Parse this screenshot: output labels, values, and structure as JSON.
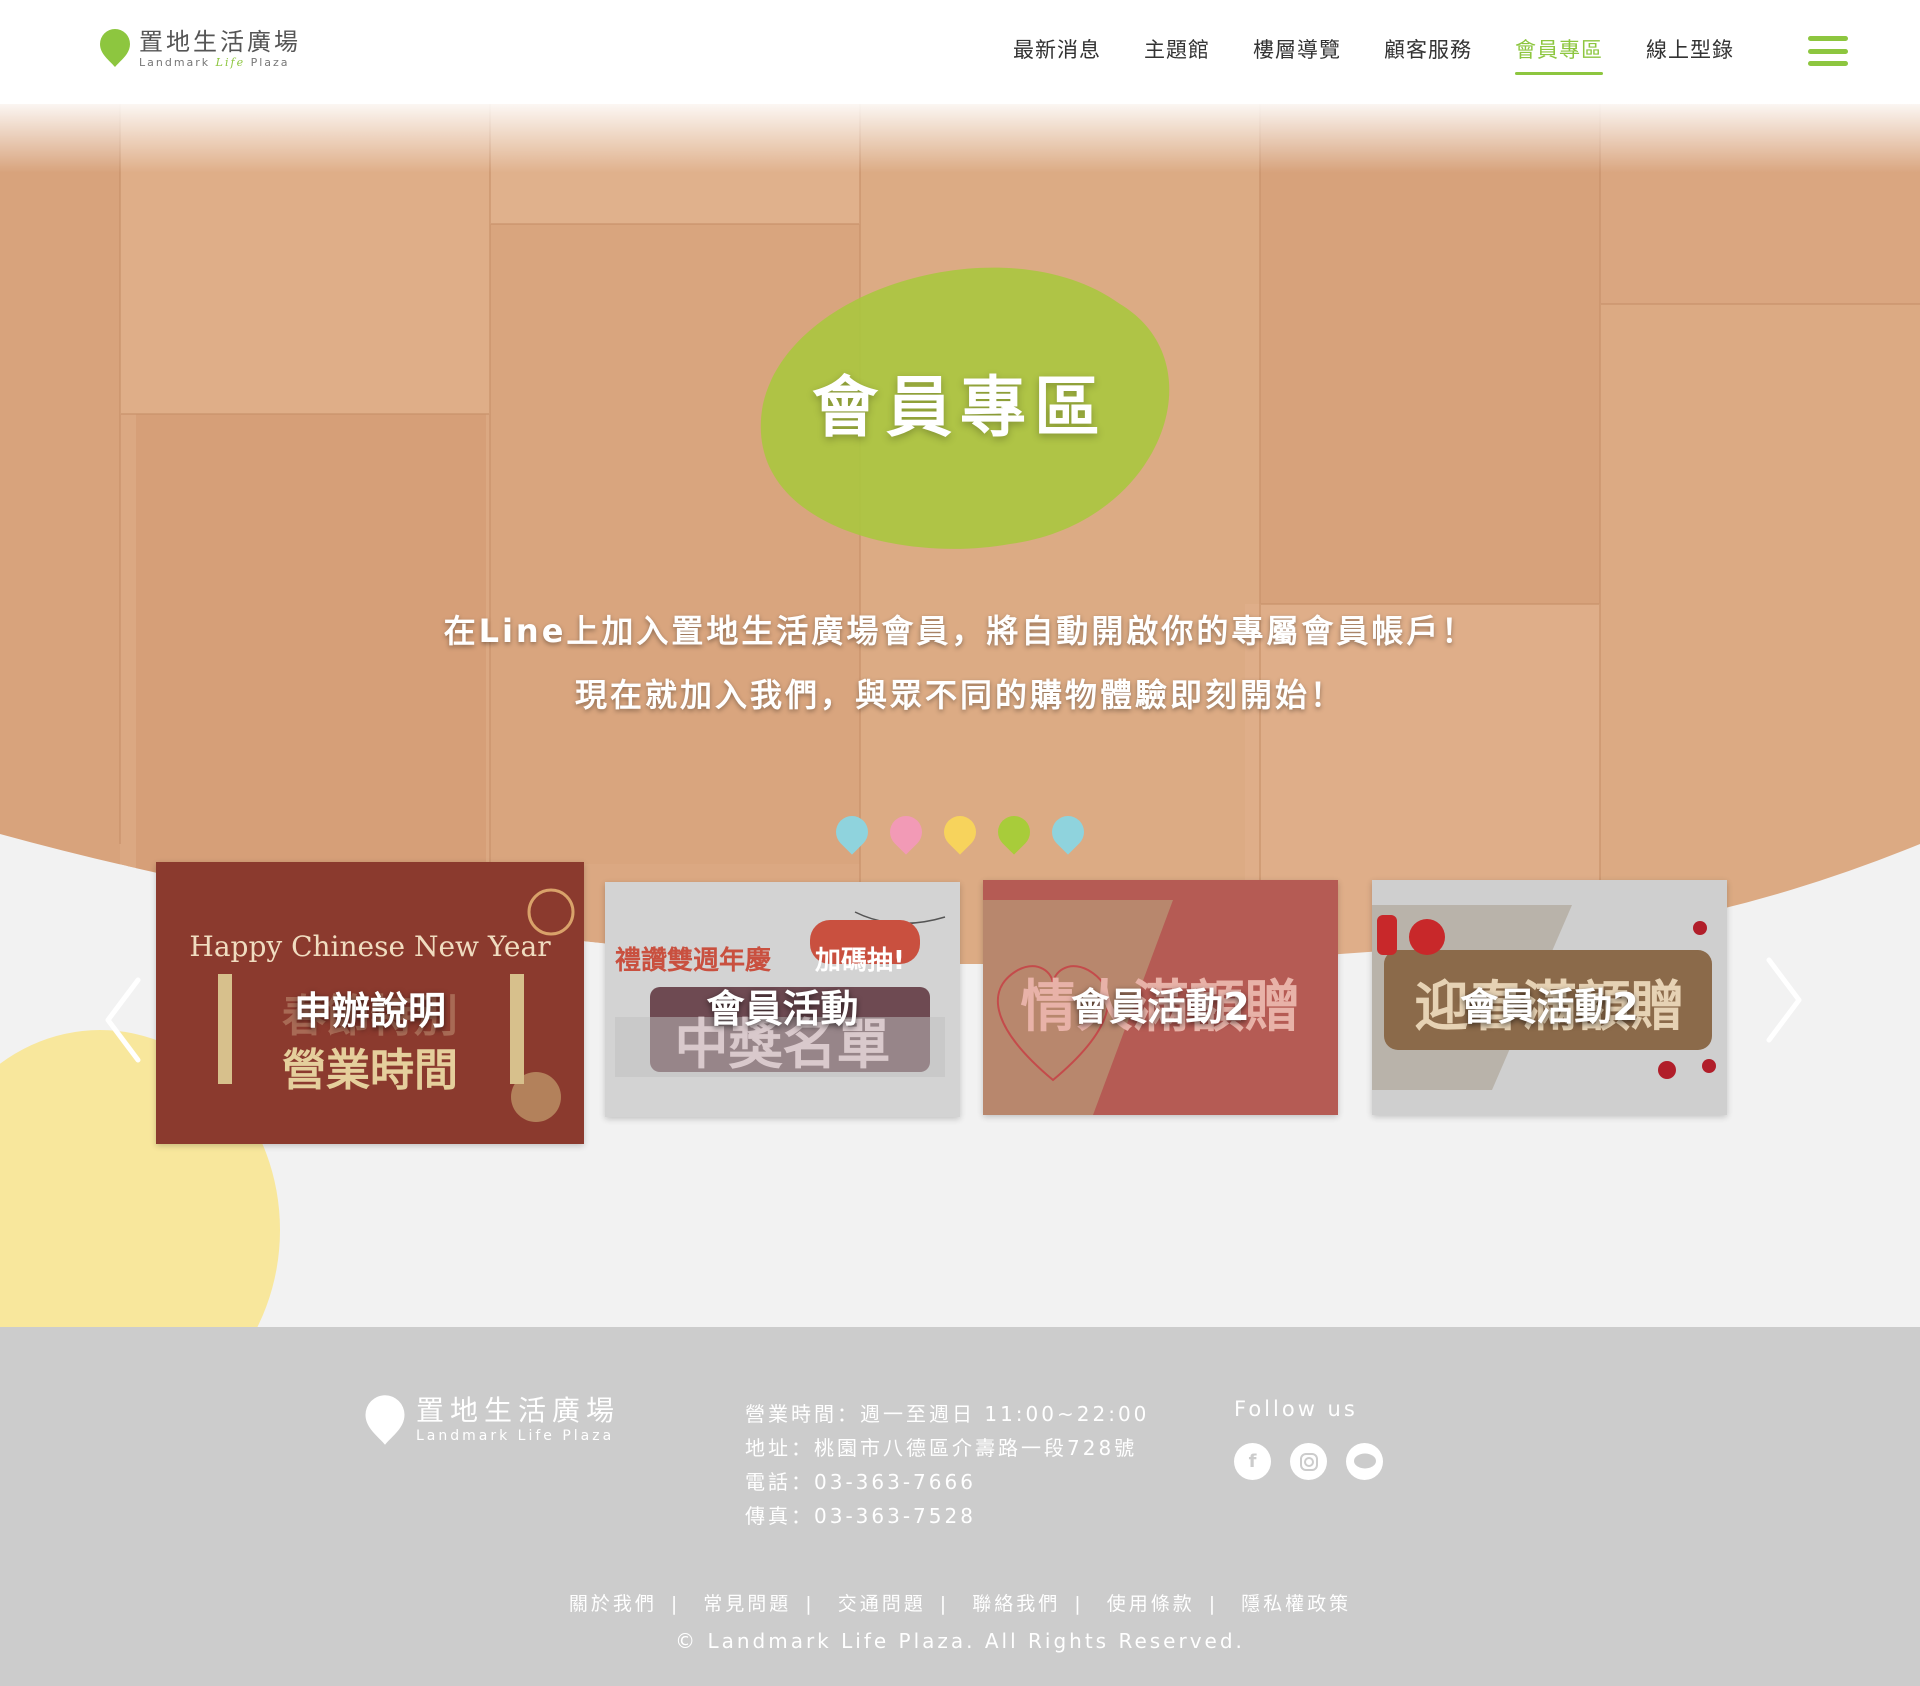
{
  "header": {
    "logo_cn": "置地生活廣場",
    "logo_en_a": "Landmark",
    "logo_en_life": "Life",
    "logo_en_b": "Plaza",
    "nav": [
      "最新消息",
      "主題館",
      "樓層導覽",
      "顧客服務",
      "會員專區",
      "線上型錄"
    ],
    "active_nav": "會員專區"
  },
  "hero": {
    "title": "會員專區",
    "desc_line1": "在Line上加入置地生活廣場會員，將自動開啟你的專屬會員帳戶！",
    "desc_line2": "現在就加入我們，與眾不同的購物體驗即刻開始！"
  },
  "dots": [
    "#8fd3dd",
    "#f29ab6",
    "#f7d35c",
    "#a8cc3a",
    "#8fd3dd"
  ],
  "cards": [
    {
      "label": "申辦說明",
      "art_top": "Happy Chinese New Year",
      "art_main": "春節特別",
      "art_sub": "營業時間"
    },
    {
      "label": "會員活動",
      "art_top": "禮讚雙週年慶",
      "art_badge": "加碼抽!",
      "art_main": "中獎名單"
    },
    {
      "label": "會員活動2",
      "art_main": "情人滿額贈"
    },
    {
      "label": "會員活動2",
      "art_main": "迎春滿額贈"
    }
  ],
  "footer": {
    "logo_cn": "置地生活廣場",
    "logo_en": "Landmark Life Plaza",
    "hours": "營業時間：週一至週日 11:00~22:00",
    "address": "地址：桃園市八德區介壽路一段728號",
    "phone": "電話：03-363-7666",
    "fax": "傳真：03-363-7528",
    "follow": "Follow us",
    "social": [
      "facebook",
      "instagram",
      "line"
    ],
    "links": [
      "關於我們",
      "常見問題",
      "交通問題",
      "聯絡我們",
      "使用條款",
      "隱私權政策"
    ],
    "copyright": "© Landmark Life Plaza. All Rights Reserved."
  },
  "colors": {
    "accent": "#8dc63f",
    "wood": "#d9a47e",
    "footer": "#cccccc",
    "yellow": "#f8e79c"
  }
}
